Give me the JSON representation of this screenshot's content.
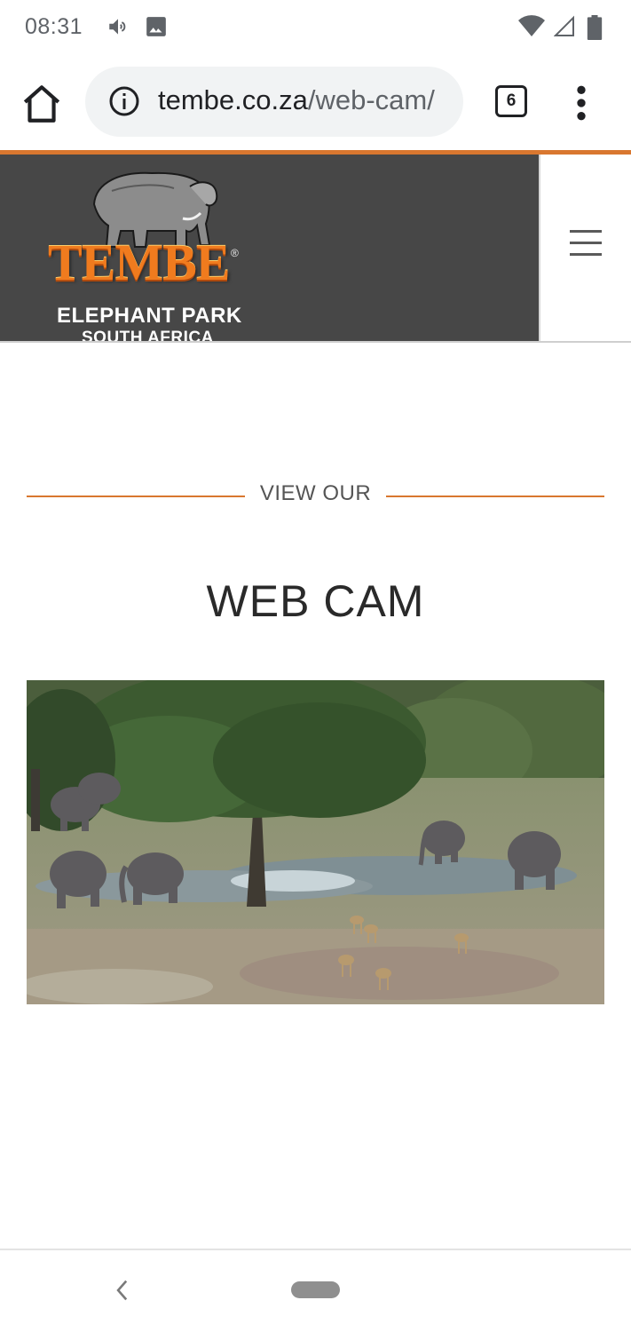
{
  "status_bar": {
    "time": "08:31",
    "left_icons": [
      "volume-icon",
      "image-notification-icon"
    ],
    "right_icons": [
      "wifi-icon",
      "cell-signal-icon",
      "battery-icon"
    ]
  },
  "browser": {
    "url_host": "tembe.co.za",
    "url_path": "/web-cam/",
    "tab_count": "6",
    "icons": [
      "home-icon",
      "info-icon",
      "tabs-icon",
      "more-vert-icon"
    ]
  },
  "site": {
    "logo": {
      "brand": "TEMBE",
      "reg_mark": "®",
      "line1": "ELEPHANT PARK",
      "line2": "SOUTH AFRICA"
    },
    "menu_icon": "hamburger-icon"
  },
  "content": {
    "kicker": "VIEW OUR",
    "title": "WEB CAM",
    "image": "webcam-feed-waterhole-elephants"
  },
  "colors": {
    "accent": "#d9772f",
    "header_bg": "#474747",
    "logo_orange": "#f07b1e"
  },
  "nav_bar": {
    "icons": [
      "back-icon",
      "home-pill"
    ]
  }
}
